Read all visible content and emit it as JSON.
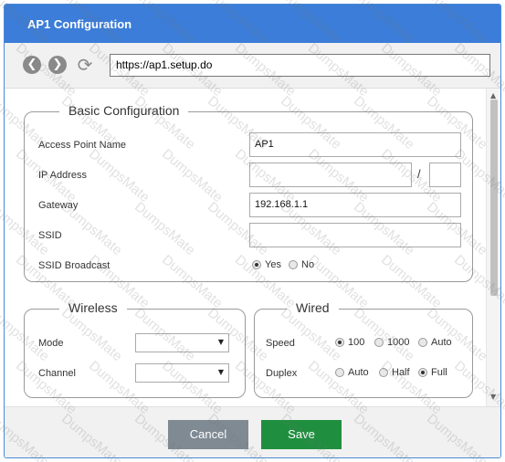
{
  "window": {
    "title": "AP1 Configuration"
  },
  "nav": {
    "url": "https://ap1.setup.do",
    "back_icon": "back-arrow-icon",
    "forward_icon": "forward-arrow-icon",
    "refresh_icon": "refresh-icon"
  },
  "basic": {
    "legend": "Basic Configuration",
    "ap_name_label": "Access Point Name",
    "ap_name_value": "AP1",
    "ip_label": "IP Address",
    "ip_value": "",
    "ip_slash": "/",
    "mask_value": "",
    "gateway_label": "Gateway",
    "gateway_value": "192.168.1.1",
    "ssid_label": "SSID",
    "ssid_value": "",
    "broadcast_label": "SSID Broadcast",
    "broadcast_options": [
      "Yes",
      "No"
    ],
    "broadcast_selected": "Yes"
  },
  "wireless": {
    "legend": "Wireless",
    "mode_label": "Mode",
    "mode_value": "",
    "channel_label": "Channel",
    "channel_value": ""
  },
  "wired": {
    "legend": "Wired",
    "speed_label": "Speed",
    "speed_options": [
      "100",
      "1000",
      "Auto"
    ],
    "speed_selected": "100",
    "duplex_label": "Duplex",
    "duplex_options": [
      "Auto",
      "Half",
      "Full"
    ],
    "duplex_selected": "Full"
  },
  "footer": {
    "cancel_label": "Cancel",
    "save_label": "Save"
  },
  "watermark": "DumpsMate",
  "colors": {
    "titlebar": "#3b7dd8",
    "save": "#1f8f3f",
    "cancel": "#7f8a93"
  }
}
